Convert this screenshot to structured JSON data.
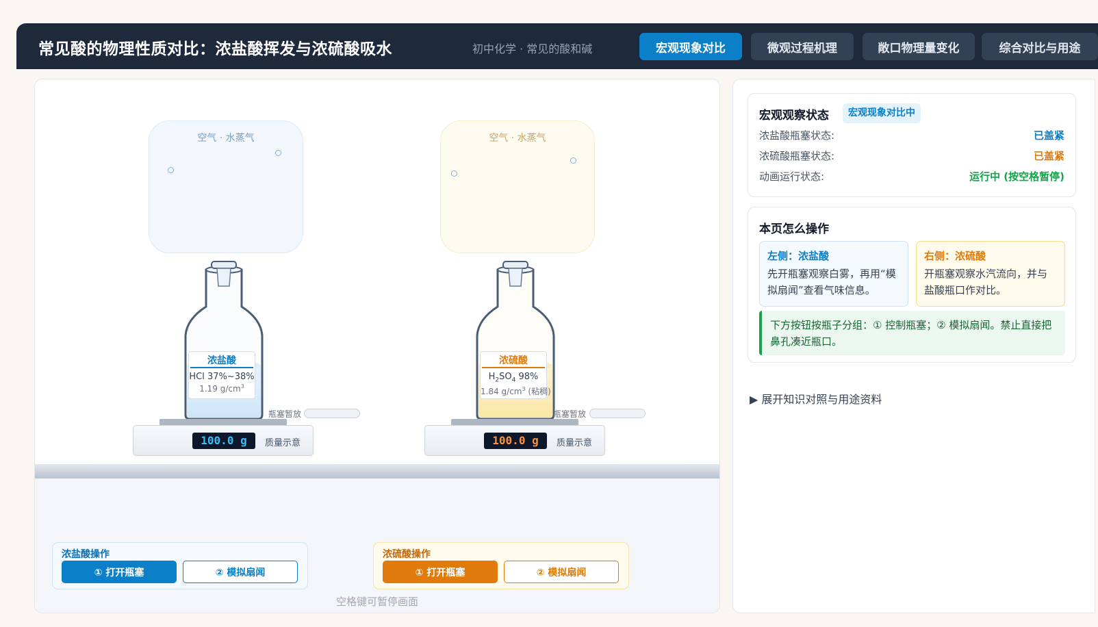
{
  "header": {
    "title": "常见酸的物理性质对比：浓盐酸挥发与浓硫酸吸水",
    "subtitle": "初中化学 · 常见的酸和碱",
    "tabs": [
      {
        "label": "宏观现象对比"
      },
      {
        "label": "微观过程机理"
      },
      {
        "label": "敞口物理量变化"
      },
      {
        "label": "综合对比与用途"
      }
    ]
  },
  "stage": {
    "hcl": {
      "cloud_label": "空气 · 水蒸气",
      "name": "浓盐酸",
      "formula_main": "HCl 37%~38%",
      "density_main": "1.19 g/cm",
      "density_sup": "3",
      "pause_label": "瓶塞暂放",
      "mass": "100.0 g",
      "mass_caption": "质量示意",
      "color": "#0b7fc7"
    },
    "h2so4": {
      "cloud_label": "空气 · 水蒸气",
      "name": "浓硫酸",
      "formula_h": "H",
      "formula_sub2": "2",
      "formula_so": "SO",
      "formula_sub4": "4",
      "formula_pct": " 98%",
      "density_main": "1.84 g/cm",
      "density_sup": "3",
      "density_note": " (粘稠)",
      "pause_label": "瓶塞暂放",
      "mass": "100.0 g",
      "mass_caption": "质量示意",
      "color": "#e07b0b"
    },
    "controls": {
      "hcl": {
        "title": "浓盐酸操作",
        "open": "① 打开瓶塞",
        "fan": "② 模拟扇闻"
      },
      "h2so4": {
        "title": "浓硫酸操作",
        "open": "① 打开瓶塞",
        "fan": "② 模拟扇闻"
      }
    },
    "hint": "空格键可暂停画面"
  },
  "side": {
    "status": {
      "title": "宏观观察状态",
      "badge": "宏观现象对比中",
      "rows": [
        {
          "key": "浓盐酸瓶塞状态:",
          "value": "已盖紧",
          "color": "#0b7fc7"
        },
        {
          "key": "浓硫酸瓶塞状态:",
          "value": "已盖紧",
          "color": "#e07b0b"
        },
        {
          "key": "动画运行状态:",
          "value": "运行中 (按空格暂停)",
          "color": "#16a34a"
        }
      ]
    },
    "howto": {
      "title": "本页怎么操作",
      "left_title": "左侧：浓盐酸",
      "left_body": "先开瓶塞观察白雾，再用“模拟扇闻”查看气味信息。",
      "right_title": "右侧：浓硫酸",
      "right_body": "开瓶塞观察水汽流向，并与盐酸瓶口作对比。",
      "note": "下方按钮按瓶子分组：① 控制瓶塞；② 模拟扇闻。禁止直接把鼻孔凑近瓶口。"
    },
    "details_label": "▶ 展开知识对照与用途资料"
  }
}
